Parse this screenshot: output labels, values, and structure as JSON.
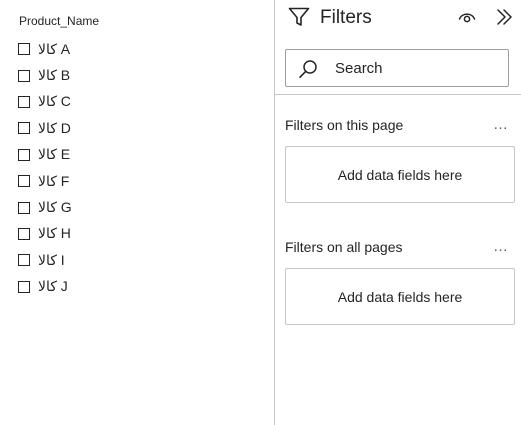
{
  "slicer": {
    "title": "Product_Name",
    "items": [
      {
        "label": "کالا A",
        "checked": false
      },
      {
        "label": "کالا B",
        "checked": false
      },
      {
        "label": "کالا C",
        "checked": false
      },
      {
        "label": "کالا D",
        "checked": false
      },
      {
        "label": "کالا E",
        "checked": false
      },
      {
        "label": "کالا F",
        "checked": false
      },
      {
        "label": "کالا G",
        "checked": false
      },
      {
        "label": "کالا H",
        "checked": false
      },
      {
        "label": "کالا I",
        "checked": false
      },
      {
        "label": "کالا J",
        "checked": false
      }
    ]
  },
  "filters_pane": {
    "title": "Filters",
    "icons": {
      "header": "funnel-icon",
      "visibility": "eye-icon",
      "collapse": "double-chevron-right-icon",
      "search": "search-icon",
      "more": "more-options-icon"
    },
    "search": {
      "placeholder": "Search"
    },
    "sections": [
      {
        "title": "Filters on this page",
        "more": "…",
        "drop_zone": "Add data fields here"
      },
      {
        "title": "Filters on all pages",
        "more": "…",
        "drop_zone": "Add data fields here"
      }
    ]
  },
  "colors": {
    "text": "#252423",
    "border": "#c8c6c4",
    "search_border": "#a19f9d"
  }
}
